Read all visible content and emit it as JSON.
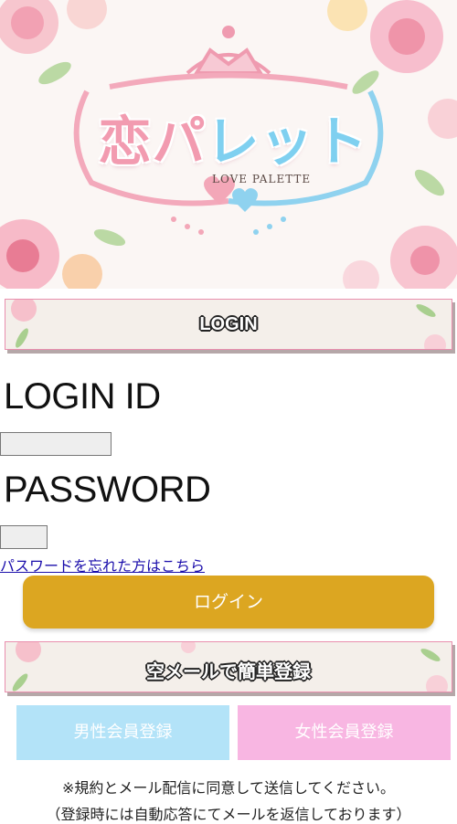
{
  "hero": {
    "logo_part1": "恋パ",
    "logo_part2": "レット",
    "logo_subtitle": "LOVE PALETTE"
  },
  "login_banner": {
    "label": "LOGIN"
  },
  "form": {
    "login_id_label": "LOGIN ID",
    "login_id_value": "",
    "password_label": "PASSWORD",
    "password_value": "",
    "forgot_link": "パスワードを忘れた方はこちら",
    "login_button": "ログイン"
  },
  "register_banner": {
    "label": "空メールで簡単登録"
  },
  "register": {
    "male_button": "男性会員登録",
    "female_button": "女性会員登録",
    "male_color": "#b3e3f8",
    "female_color": "#f8b6e2"
  },
  "notice": {
    "line1": "※規約とメール配信に同意して送信してください。",
    "line2": "（登録時には自動応答にてメールを返信しております）"
  },
  "colors": {
    "accent_gold": "#dca621",
    "banner_border": "#e98fae",
    "link": "#1a0dab"
  }
}
